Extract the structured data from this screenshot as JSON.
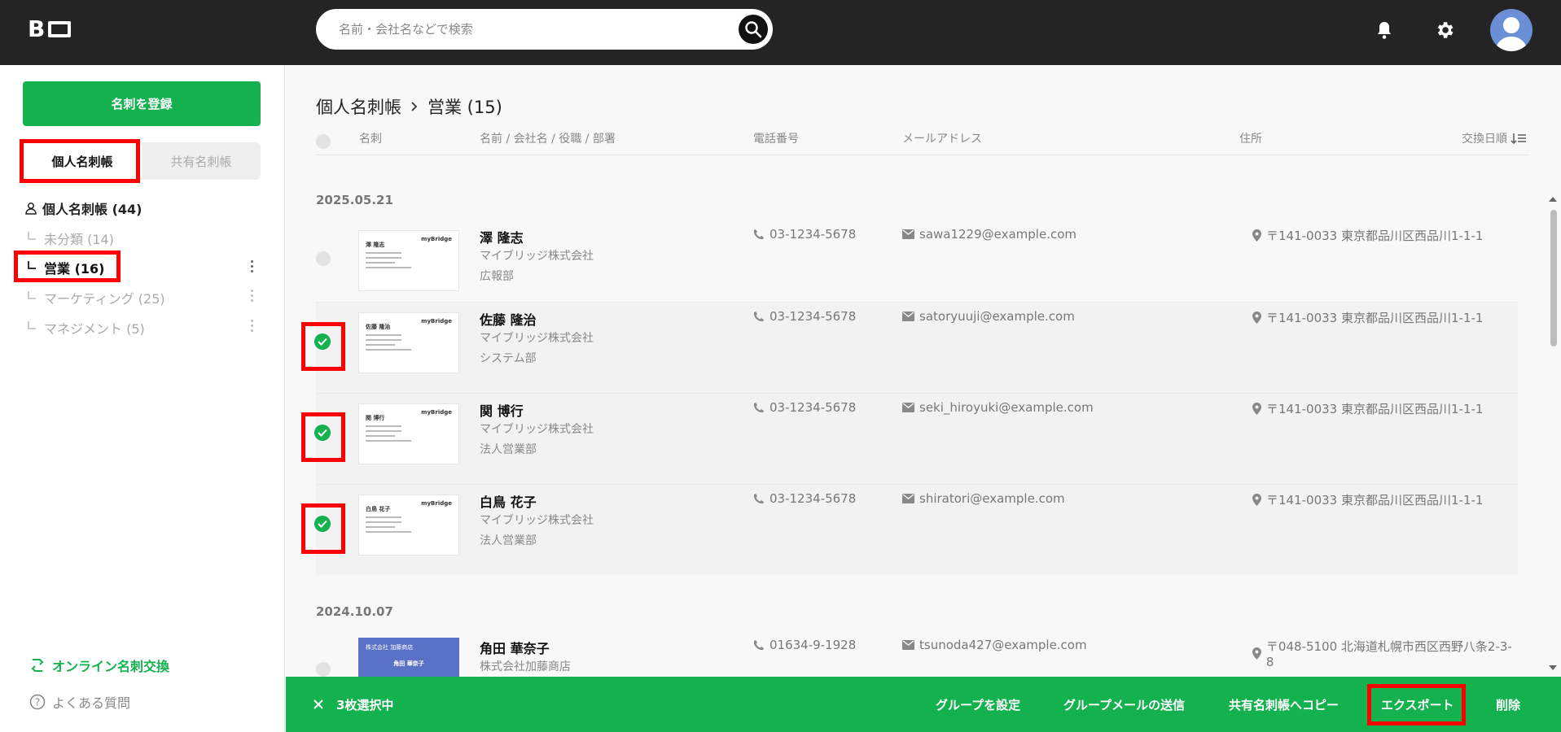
{
  "header": {
    "logo_text": "B",
    "search_placeholder": "名前・会社名などで検索"
  },
  "sidebar": {
    "register_button": "名刺を登録",
    "tabs": [
      "個人名刺帳",
      "共有名刺帳"
    ],
    "tree_root": "個人名刺帳 (44)",
    "groups": [
      {
        "label": "未分類 (14)"
      },
      {
        "label": "営業 (16)"
      },
      {
        "label": "マーケティング (25)"
      },
      {
        "label": "マネジメント (5)"
      }
    ],
    "online_exchange": "オンライン名刺交換",
    "faq": "よくある質問"
  },
  "main": {
    "breadcrumb": [
      "個人名刺帳",
      "営業 (15)"
    ],
    "columns": [
      "名刺",
      "名前 / 会社名 / 役職 / 部署",
      "電話番号",
      "メールアドレス",
      "住所",
      "交換日順"
    ],
    "groups": [
      {
        "date": "2025.05.21",
        "rows": [
          {
            "name": "澤 隆志",
            "company": "マイブリッジ株式会社",
            "dept": "広報部",
            "phone": "03-1234-5678",
            "email": "sawa1229@example.com",
            "address": "〒141-0033 東京都品川区西品川1-1-1",
            "card_brand": "myBridge",
            "card_name": "澤 隆志"
          },
          {
            "name": "佐藤 隆治",
            "company": "マイブリッジ株式会社",
            "dept": "システム部",
            "phone": "03-1234-5678",
            "email": "satoryuuji@example.com",
            "address": "〒141-0033 東京都品川区西品川1-1-1",
            "card_brand": "myBridge",
            "card_name": "佐藤 隆治"
          },
          {
            "name": "関 博行",
            "company": "マイブリッジ株式会社",
            "dept": "法人営業部",
            "phone": "03-1234-5678",
            "email": "seki_hiroyuki@example.com",
            "address": "〒141-0033 東京都品川区西品川1-1-1",
            "card_brand": "myBridge",
            "card_name": "関 博行"
          },
          {
            "name": "白鳥 花子",
            "company": "マイブリッジ株式会社",
            "dept": "法人営業部",
            "phone": "03-1234-5678",
            "email": "shiratori@example.com",
            "address": "〒141-0033 東京都品川区西品川1-1-1",
            "card_brand": "myBridge",
            "card_name": "白鳥 花子"
          }
        ]
      },
      {
        "date": "2024.10.07",
        "rows": [
          {
            "name": "角田 華奈子",
            "company": "株式会社加藤商店",
            "dept": "",
            "phone": "01634-9-1928",
            "email": "tsunoda427@example.com",
            "address": "〒048-5100 北海道札幌市西区西野八条2-3-8",
            "card_brand": "株式会社 加藤商店",
            "card_name": "角田 華奈子"
          }
        ]
      }
    ]
  },
  "action_bar": {
    "selected": "3枚選択中",
    "actions": [
      "グループを設定",
      "グループメールの送信",
      "共有名刺帳へコピー",
      "エクスポート",
      "削除"
    ]
  },
  "colors": {
    "accent": "#14b14f",
    "topbar": "#242424",
    "highlight": "#ff0000"
  }
}
